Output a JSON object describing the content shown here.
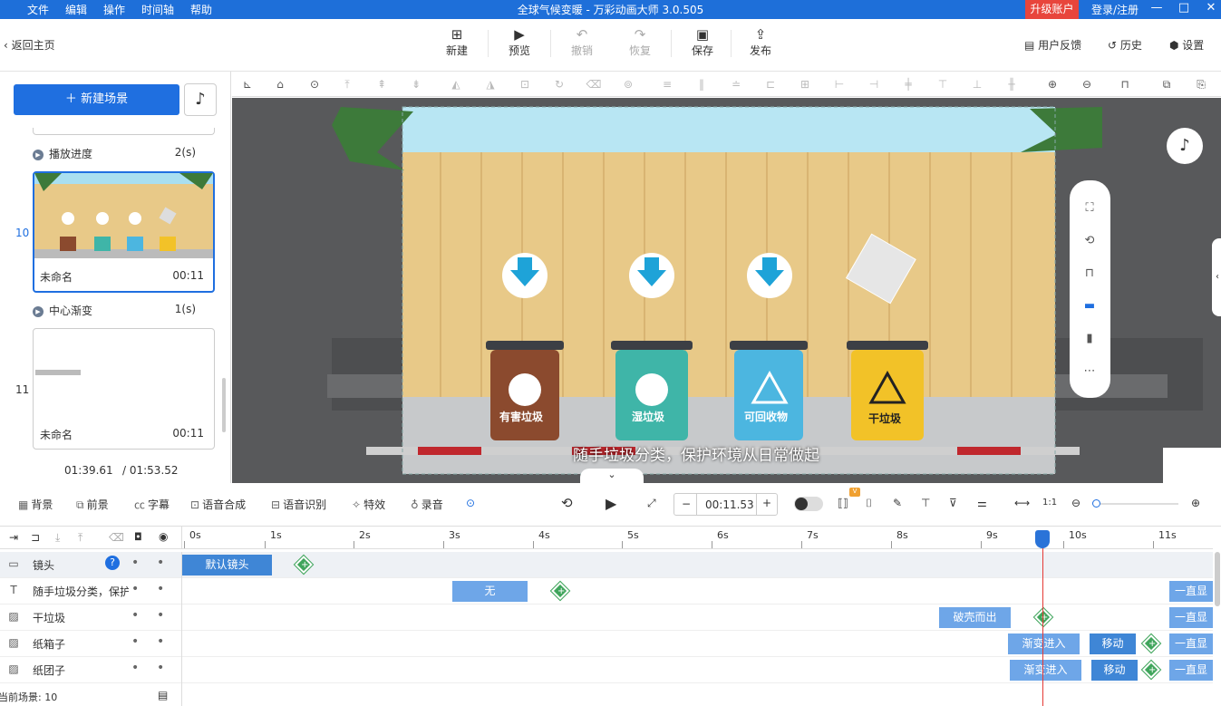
{
  "titlebar": {
    "menu": [
      "文件",
      "编辑",
      "操作",
      "时间轴",
      "帮助"
    ],
    "title": "全球气候变暖 - 万彩动画大师 3.0.505",
    "upgrade": "升级账户",
    "login": "登录/注册",
    "min": "—",
    "max": "□",
    "close": "✕"
  },
  "toolbar": {
    "back": "返回主页",
    "new": "新建",
    "preview": "预览",
    "undo": "撤销",
    "redo": "恢复",
    "save": "保存",
    "publish": "发布",
    "feedback": "用户反馈",
    "history": "历史",
    "settings": "设置"
  },
  "left": {
    "new_scene": "新建场景",
    "transitions": [
      {
        "label": "播放进度",
        "dur": "2(s)"
      },
      {
        "label": "中心渐变",
        "dur": "1(s)"
      }
    ],
    "scenes": [
      {
        "num": "10",
        "name": "未命名",
        "time": "00:11"
      },
      {
        "num": "11",
        "name": "未命名",
        "time": "00:11"
      }
    ],
    "current_time": "01:39.61",
    "total_time": "/ 01:53.52"
  },
  "canvas": {
    "bins": [
      "有害垃圾",
      "湿垃圾",
      "可回收物",
      "干垃圾"
    ],
    "subtitle": "随手垃圾分类，保护环境从日常做起",
    "colors": {
      "harmful": "#8b4a2e",
      "wet": "#3fb5a8",
      "recyclable": "#4cb6e0",
      "dry": "#f2c228",
      "fence": "#e8c988"
    }
  },
  "ctrl": {
    "bg": "背景",
    "fg": "前景",
    "caption": "字幕",
    "tts": "语音合成",
    "asr": "语音识别",
    "fx": "特效",
    "record": "录音",
    "time": "00:11.53",
    "minus": "−",
    "plus": "+"
  },
  "timeline": {
    "ticks": [
      "0s",
      "1s",
      "2s",
      "3s",
      "4s",
      "5s",
      "6s",
      "7s",
      "8s",
      "9s",
      "10s",
      "11s"
    ],
    "tracks": [
      {
        "name": "镜头",
        "blocks": [
          "默认镜头"
        ]
      },
      {
        "name": "随手垃圾分类，保护",
        "blocks": [
          "无",
          "一直显"
        ]
      },
      {
        "name": "干垃圾",
        "blocks": [
          "破壳而出",
          "一直显"
        ]
      },
      {
        "name": "纸箱子",
        "blocks": [
          "渐变进入",
          "移动",
          "一直显"
        ]
      },
      {
        "name": "纸团子",
        "blocks": [
          "渐变进入",
          "移动",
          "一直显"
        ]
      }
    ],
    "current_scene": "当前场景: 10"
  }
}
